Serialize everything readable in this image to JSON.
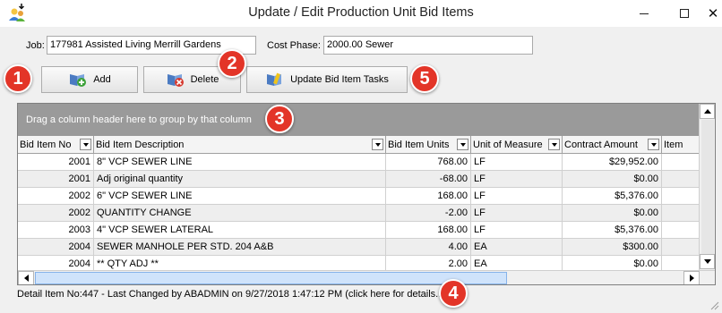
{
  "window": {
    "title": "Update / Edit Production Unit Bid Items"
  },
  "header": {
    "job_label": "Job:",
    "job_value": "177981 Assisted Living Merrill Gardens",
    "phase_label": "Cost Phase:",
    "phase_value": "2000.00 Sewer"
  },
  "toolbar": {
    "add_label": "Add",
    "delete_label": "Delete",
    "update_tasks_label": "Update Bid Item Tasks"
  },
  "grid": {
    "group_hint": "Drag a column header here to group by that column",
    "columns": [
      "Bid Item No",
      "Bid Item Description",
      "Bid Item Units",
      "Unit of Measure",
      "Contract Amount",
      "Item"
    ],
    "rows": [
      {
        "no": "2001",
        "desc": "8\" VCP SEWER LINE",
        "units": "768.00",
        "uom": "LF",
        "amount": "$29,952.00"
      },
      {
        "no": "2001",
        "desc": "Adj original quantity",
        "units": "-68.00",
        "uom": "LF",
        "amount": "$0.00"
      },
      {
        "no": "2002",
        "desc": "6\" VCP SEWER LINE",
        "units": "168.00",
        "uom": "LF",
        "amount": "$5,376.00"
      },
      {
        "no": "2002",
        "desc": "QUANTITY CHANGE",
        "units": "-2.00",
        "uom": "LF",
        "amount": "$0.00"
      },
      {
        "no": "2003",
        "desc": "4\" VCP SEWER LATERAL",
        "units": "168.00",
        "uom": "LF",
        "amount": "$5,376.00"
      },
      {
        "no": "2004",
        "desc": "SEWER MANHOLE PER STD. 204 A&B",
        "units": "4.00",
        "uom": "EA",
        "amount": "$300.00"
      },
      {
        "no": "2004",
        "desc": "** QTY ADJ **",
        "units": "2.00",
        "uom": "EA",
        "amount": "$0.00"
      }
    ]
  },
  "status": {
    "text": "Detail Item No:447 - Last Changed by ABADMIN on 9/27/2018 1:47:12 PM (click here for details...)"
  },
  "callouts": [
    "1",
    "2",
    "3",
    "4",
    "5"
  ],
  "colors": {
    "callout": "#e33528",
    "group_bar": "#9a9a9a",
    "scroll_thumb": "#cfe3fb"
  }
}
